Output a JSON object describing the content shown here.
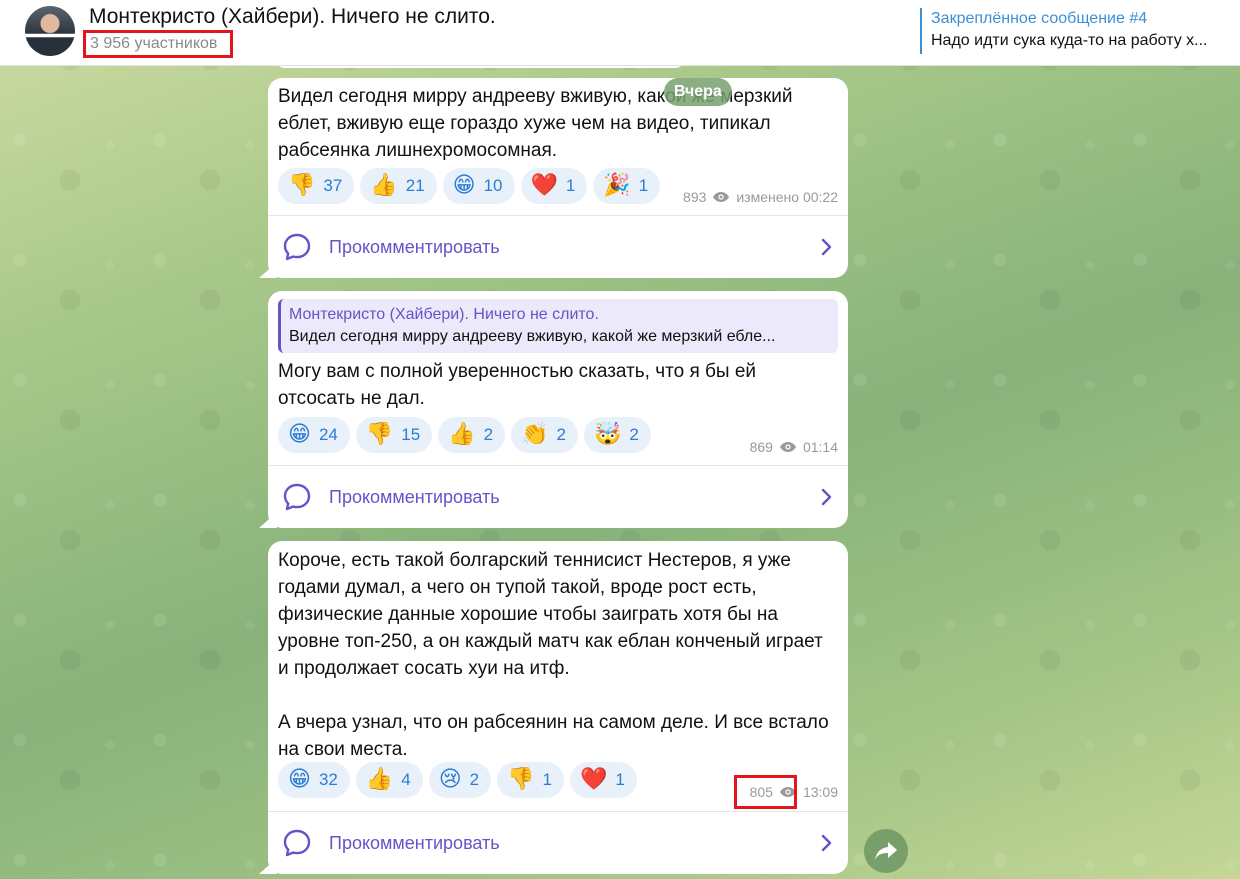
{
  "header": {
    "title": "Монтекристо (Хайбери). Ничего не слито.",
    "subtitle": "3 956 участников",
    "pinned_title": "Закреплённое сообщение #4",
    "pinned_text": "Надо идти сука куда-то на работу х..."
  },
  "date_pill": "Вчера",
  "comment_label": "Прокомментировать",
  "messages": [
    {
      "text": "Видел сегодня мирру андрееву вживую, какой же мерзкий еблет, вживую еще гораздо хуже чем на видео, типикал рабсеянка лишнехромосомная.",
      "reactions": [
        {
          "emoji": "👎",
          "count": "37"
        },
        {
          "emoji": "👍",
          "count": "21"
        },
        {
          "emoji": "😁",
          "count": "10"
        },
        {
          "emoji": "❤️",
          "count": "1"
        },
        {
          "emoji": "🎉",
          "count": "1"
        }
      ],
      "views": "893",
      "time": "изменено 00:22"
    },
    {
      "quote_title": "Монтекристо (Хайбери). Ничего не слито.",
      "quote_text": "Видел сегодня мирру андрееву вживую, какой же мерзкий ебле...",
      "text": "Могу вам с полной уверенностью сказать, что я бы ей отсосать не дал.",
      "reactions": [
        {
          "emoji": "😁",
          "count": "24"
        },
        {
          "emoji": "👎",
          "count": "15"
        },
        {
          "emoji": "👍",
          "count": "2"
        },
        {
          "emoji": "👏",
          "count": "2"
        },
        {
          "emoji": "🤯",
          "count": "2"
        }
      ],
      "views": "869",
      "time": "01:14"
    },
    {
      "text": "Короче, есть такой болгарский теннисист Нестеров, я уже годами думал, а чего он тупой такой, вроде рост есть, физические данные хорошие чтобы заиграть хотя бы на уровне топ-250, а он каждый матч как еблан конченый играет и продолжает сосать хуи на итф.\n\nА вчера узнал, что он рабсеянин на самом деле. И все встало на свои места.",
      "reactions": [
        {
          "emoji": "😁",
          "count": "32"
        },
        {
          "emoji": "👍",
          "count": "4"
        },
        {
          "emoji": "😢",
          "count": "2"
        },
        {
          "emoji": "👎",
          "count": "1"
        },
        {
          "emoji": "❤️",
          "count": "1"
        }
      ],
      "views": "805",
      "time": "13:09"
    }
  ],
  "colors": {
    "accent": "#6a51c8",
    "link": "#3a8fd6",
    "highlight": "#e2141c"
  }
}
